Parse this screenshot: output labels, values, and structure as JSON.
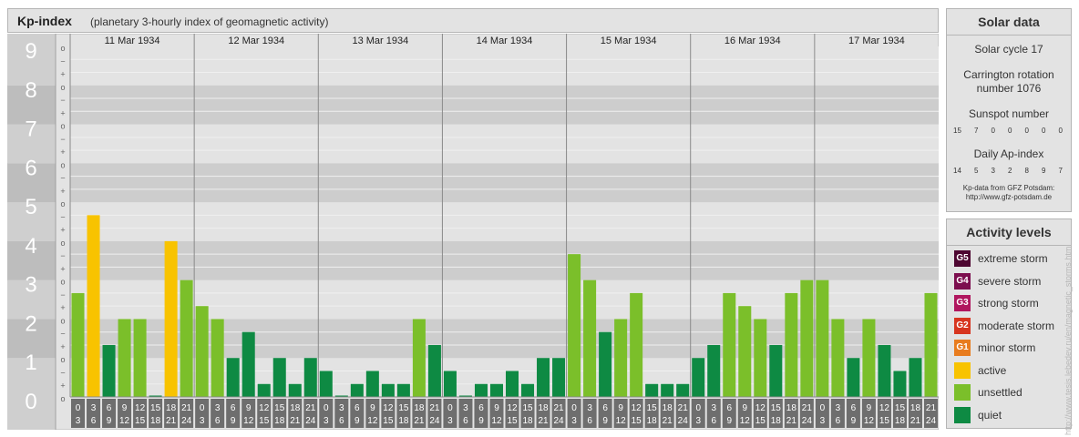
{
  "header": {
    "title": "Kp-index",
    "subtitle": "(planetary 3-hourly index of geomagnetic activity)"
  },
  "chart_data": {
    "type": "bar",
    "title": "Kp-index",
    "subtitle": "(planetary 3-hourly index of geomagnetic activity)",
    "ylim": [
      0,
      9
    ],
    "y_major_ticks": [
      "0",
      "1",
      "2",
      "3",
      "4",
      "5",
      "6",
      "7",
      "8",
      "9"
    ],
    "y_minor_labels": [
      "o",
      "+",
      "−"
    ],
    "grid": true,
    "days": [
      "11 Mar 1934",
      "12 Mar 1934",
      "13 Mar 1934",
      "14 Mar 1934",
      "15 Mar 1934",
      "16 Mar 1934",
      "17 Mar 1934"
    ],
    "interval_labels": [
      [
        "0",
        "3"
      ],
      [
        "3",
        "6"
      ],
      [
        "6",
        "9"
      ],
      [
        "9",
        "12"
      ],
      [
        "12",
        "15"
      ],
      [
        "15",
        "18"
      ],
      [
        "18",
        "21"
      ],
      [
        "21",
        "24"
      ]
    ],
    "values": [
      [
        2.667,
        4.667,
        1.333,
        2.0,
        2.0,
        0.0,
        4.0,
        3.0
      ],
      [
        2.333,
        2.0,
        1.0,
        1.667,
        0.333,
        1.0,
        0.333,
        1.0
      ],
      [
        0.667,
        0.0,
        0.333,
        0.667,
        0.333,
        0.333,
        2.0,
        1.333
      ],
      [
        0.667,
        0.0,
        0.333,
        0.333,
        0.667,
        0.333,
        1.0,
        1.0
      ],
      [
        3.667,
        3.0,
        1.667,
        2.0,
        2.667,
        0.333,
        0.333,
        0.333
      ],
      [
        1.0,
        1.333,
        2.667,
        2.333,
        2.0,
        1.333,
        2.667,
        3.0
      ],
      [
        3.0,
        2.0,
        1.0,
        2.0,
        1.333,
        0.667,
        1.0,
        2.667
      ]
    ],
    "colors": {
      "quiet": "#0e8a43",
      "unsettled": "#7bbf2a",
      "active": "#f8c300",
      "G1": "#e87c1e",
      "G2": "#d7351f",
      "G3": "#b0165e",
      "G4": "#7c0e4e",
      "G5": "#4e0731"
    }
  },
  "solar": {
    "title": "Solar data",
    "cycle": "Solar cycle 17",
    "rotation": [
      "Carrington rotation",
      "number 1076"
    ],
    "sunspot_label": "Sunspot number",
    "sunspot_values": [
      "15",
      "7",
      "0",
      "0",
      "0",
      "0",
      "0"
    ],
    "ap_label": "Daily Ap-index",
    "ap_values": [
      "14",
      "5",
      "3",
      "2",
      "8",
      "9",
      "7"
    ],
    "credit": [
      "Kp-data from GFZ Potsdam:",
      "http://www.gfz-potsdam.de"
    ]
  },
  "activity": {
    "title": "Activity levels",
    "items": [
      {
        "code": "G5",
        "label": "extreme storm",
        "color": "#4e0731"
      },
      {
        "code": "G4",
        "label": "severe storm",
        "color": "#7c0e4e"
      },
      {
        "code": "G3",
        "label": "strong storm",
        "color": "#b0165e"
      },
      {
        "code": "G2",
        "label": "moderate storm",
        "color": "#d7351f"
      },
      {
        "code": "G1",
        "label": "minor storm",
        "color": "#e87c1e"
      },
      {
        "code": "",
        "label": "active",
        "color": "#f8c300"
      },
      {
        "code": "",
        "label": "unsettled",
        "color": "#7bbf2a"
      },
      {
        "code": "",
        "label": "quiet",
        "color": "#0e8a43"
      }
    ]
  },
  "watermark": "http://www.tesis.lebedev.ru/en/magnetic_storms.html"
}
